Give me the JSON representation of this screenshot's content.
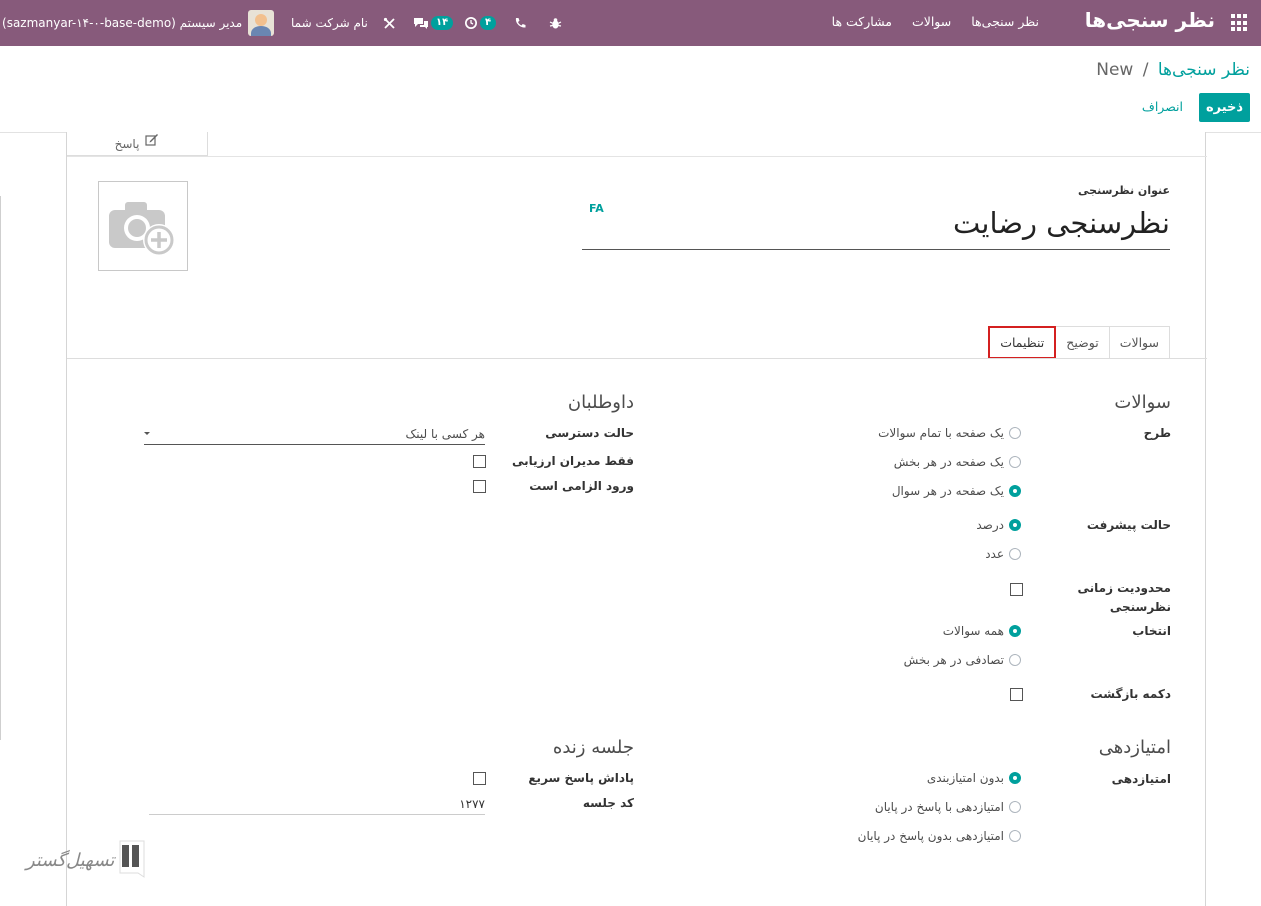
{
  "navbar": {
    "brand": "نظر سنجی‌ها",
    "menu": [
      "نظر سنجی‌ها",
      "سوالات",
      "مشارکت ها"
    ],
    "company": "نام شرکت شما",
    "messages_badge": "۱۴",
    "activities_badge": "۴",
    "user_name": "مدیر سیستم (sazmanyar-۱۴-۰-base-demo)",
    "accent": "#875a7b"
  },
  "breadcrumb": {
    "parent": "نظر سنجی‌ها",
    "separator": "/",
    "current": "New"
  },
  "buttons": {
    "save": "ذخیره",
    "discard": "انصراف"
  },
  "stat_button": {
    "label": "پاسخ"
  },
  "form": {
    "title_label": "عنوان نظرسنجی",
    "title_value": "نظرسنجی رضایت",
    "lang": "FA"
  },
  "tabs": [
    {
      "label": "سوالات",
      "active": false
    },
    {
      "label": "توضیح",
      "active": false
    },
    {
      "label": "تنظیمات",
      "active": true
    }
  ],
  "questions_group": {
    "title": "سوالات",
    "layout_label": "طرح",
    "layout_options": [
      {
        "label": "یک صفحه با تمام سوالات",
        "selected": false
      },
      {
        "label": "یک صفحه در هر بخش",
        "selected": false
      },
      {
        "label": "یک صفحه در هر سوال",
        "selected": true
      }
    ],
    "progress_label": "حالت پیشرفت",
    "progress_options": [
      {
        "label": "درصد",
        "selected": true
      },
      {
        "label": "عدد",
        "selected": false
      }
    ],
    "time_limit_label_1": "محدودیت زمانی",
    "time_limit_label_2": "نظرسنجی",
    "selection_label": "انتخاب",
    "selection_options": [
      {
        "label": "همه سوالات",
        "selected": true
      },
      {
        "label": "تصادفی در هر بخش",
        "selected": false
      }
    ],
    "back_button_label": "دکمه بازگشت"
  },
  "candidates_group": {
    "title": "داوطلبان",
    "access_mode_label": "حالت دسترسی",
    "access_mode_value": "هر کسی با لینک",
    "only_managers_label": "فقط مدیران ارزیابی",
    "login_required_label": "ورود الزامی است"
  },
  "scoring_group": {
    "title": "امتیازدهی",
    "scoring_label": "امتیازدهی",
    "options": [
      {
        "label": "بدون امتیازبندی",
        "selected": true
      },
      {
        "label": "امتیازدهی با پاسخ در پایان",
        "selected": false
      },
      {
        "label": "امتیازدهی بدون پاسخ در پایان",
        "selected": false
      }
    ]
  },
  "live_session_group": {
    "title": "جلسه زنده",
    "speed_reward_label": "پاداش پاسخ سریع",
    "session_code_label": "کد جلسه",
    "session_code_value": "۱۲۷۷"
  },
  "watermark": {
    "text": "تسهیل‌گستر"
  }
}
